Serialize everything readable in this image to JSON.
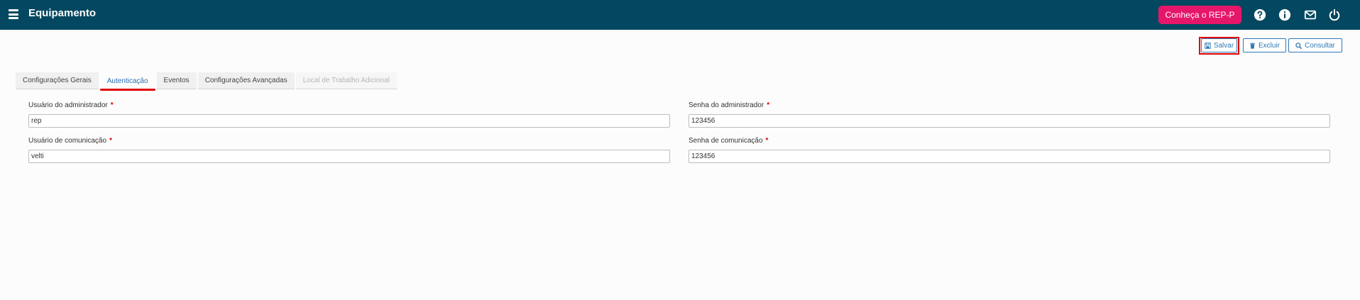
{
  "header": {
    "title": "Equipamento",
    "rep_button_label": "Conheça o REP-P",
    "icons": [
      "help-icon",
      "info-icon",
      "mail-icon",
      "power-icon"
    ]
  },
  "toolbar": {
    "save_label": "Salvar",
    "delete_label": "Excluir",
    "search_label": "Consultar"
  },
  "tabs": [
    {
      "label": "Configurações Gerais",
      "state": "normal"
    },
    {
      "label": "Autenticação",
      "state": "active"
    },
    {
      "label": "Eventos",
      "state": "normal"
    },
    {
      "label": "Configurações Avançadas",
      "state": "normal"
    },
    {
      "label": "Local de Trabalho Adicional",
      "state": "disabled"
    }
  ],
  "form": {
    "admin_user": {
      "label": "Usuário do administrador",
      "value": "rep"
    },
    "admin_password": {
      "label": "Senha do administrador",
      "value": "123456"
    },
    "comm_user": {
      "label": "Usuário de comunicação",
      "value": "velti"
    },
    "comm_password": {
      "label": "Senha de comunicação",
      "value": "123456"
    },
    "required_mark": "*"
  },
  "colors": {
    "header_bg": "#034860",
    "rep_button_bg": "#e6166b",
    "accent_blue": "#2f78b4",
    "required_red": "#e00000"
  }
}
